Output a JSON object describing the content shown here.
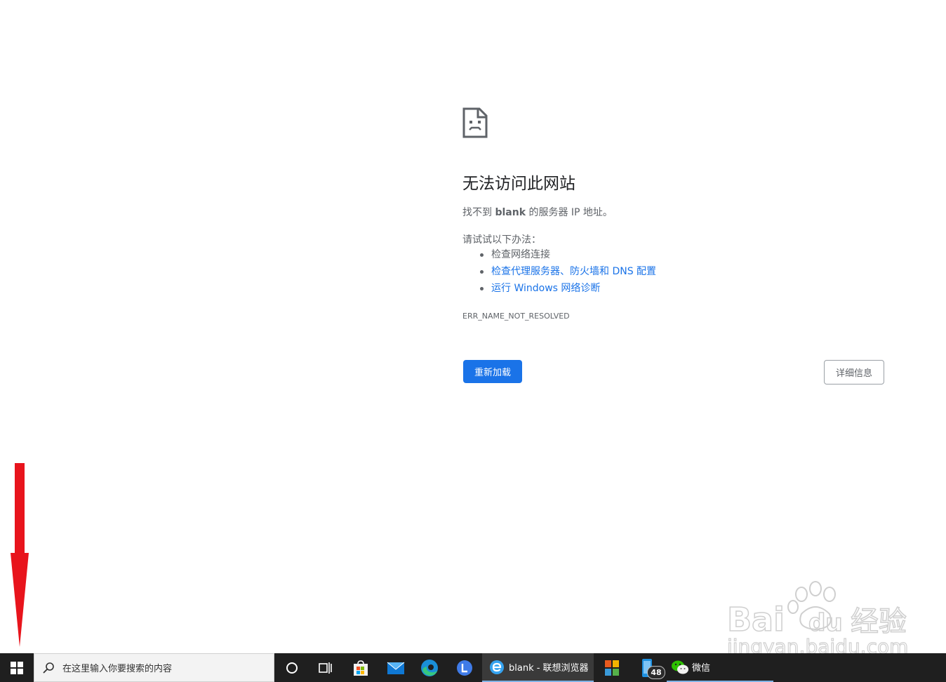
{
  "error_page": {
    "title": "无法访问此网站",
    "desc_prefix": "找不到 ",
    "desc_host": "blank",
    "desc_suffix": " 的服务器 IP 地址。",
    "try_label": "请试试以下办法：",
    "suggestions": [
      "检查网络连接",
      "检查代理服务器、防火墙和 DNS 配置",
      "运行 Windows 网络诊断"
    ],
    "error_code": "ERR_NAME_NOT_RESOLVED",
    "reload_button": "重新加载",
    "details_button": "详细信息",
    "link_color": "#1a73e8"
  },
  "taskbar": {
    "search_placeholder": "在这里输入你要搜索的内容",
    "icons": [
      "windows-start-icon",
      "search-icon",
      "cortana-icon",
      "task-view-icon",
      "store-icon",
      "mail-icon",
      "edge-icon",
      "lenovo-browser-icon",
      "app-icon",
      "phone-app-icon",
      "wechat-icon"
    ],
    "active_browser_label": "blank - 联想浏览器",
    "notification_count": "48",
    "wechat_label": "微信"
  },
  "watermark": {
    "brand": "Baidu经验",
    "url": "jingyan.baidu.com"
  },
  "annotation_color": "#e8141c"
}
